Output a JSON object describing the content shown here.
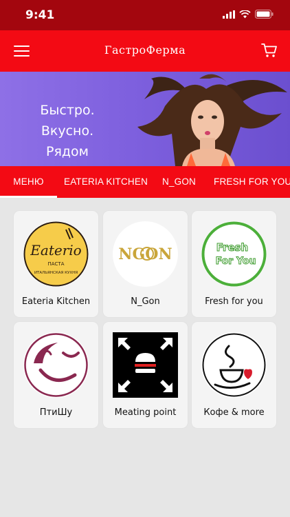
{
  "status_bar": {
    "time": "9:41"
  },
  "header": {
    "brand": "ГастроФерма"
  },
  "banner": {
    "slogan_line1": "Быстро.",
    "slogan_line2": "Вкусно. Рядом"
  },
  "tabs": [
    {
      "label": "МЕНЮ",
      "active": true
    },
    {
      "label": "EATERIA KITCHEN",
      "active": false
    },
    {
      "label": "N_GON",
      "active": false
    },
    {
      "label": "FRESH FOR YOU",
      "active": false
    }
  ],
  "restaurants": [
    {
      "name": "Eateria Kitchen",
      "logo_text": "Eaterio",
      "logo_sub1": "ПАСТА",
      "logo_sub2": "ИТАЛЬЯНСКАЯ КУХНЯ"
    },
    {
      "name": "N_Gon",
      "logo_text": "NGON"
    },
    {
      "name": "Fresh for you",
      "logo_text1": "Fresh",
      "logo_text2": "For You"
    },
    {
      "name": "ПтиШу"
    },
    {
      "name": "Meating point"
    },
    {
      "name": "Кофе & more"
    }
  ],
  "colors": {
    "brand_red": "#f30a14",
    "status_red": "#a3060e",
    "banner_purple": "#7e60de",
    "background": "#e6e6e6"
  }
}
